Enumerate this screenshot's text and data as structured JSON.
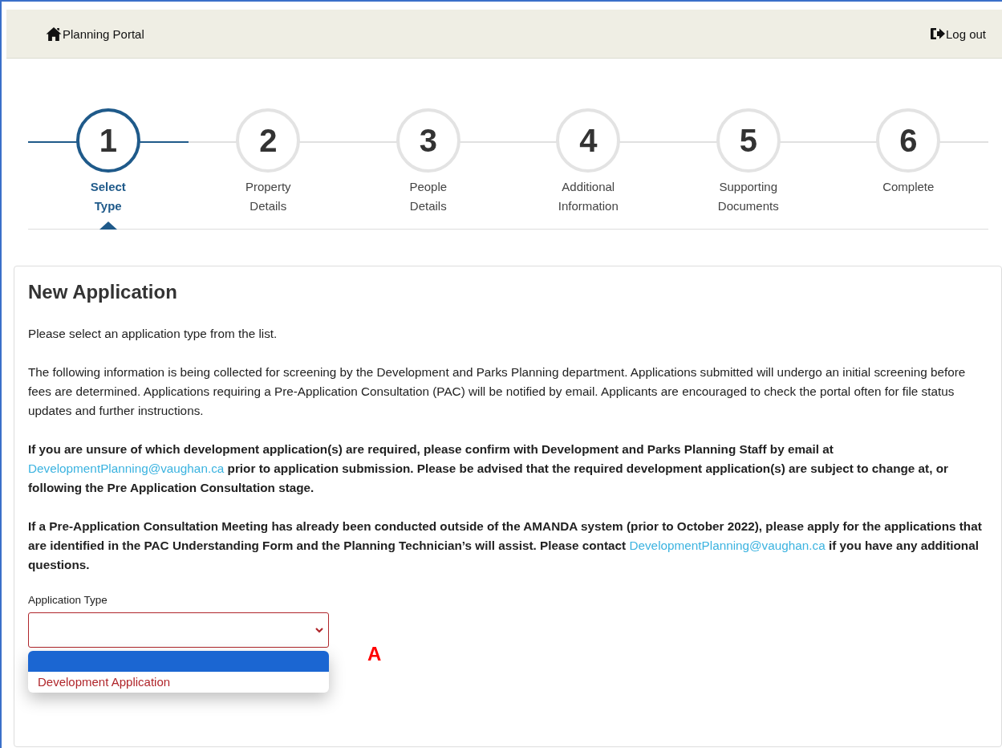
{
  "header": {
    "home": "Planning Portal",
    "logout": "Log out"
  },
  "steps": [
    {
      "number": "1",
      "label": "Select Type",
      "selected": true
    },
    {
      "number": "2",
      "label": "Property Details",
      "selected": false
    },
    {
      "number": "3",
      "label": "People Details",
      "selected": false
    },
    {
      "number": "4",
      "label": "Additional Information",
      "selected": false
    },
    {
      "number": "5",
      "label": "Supporting Documents",
      "selected": false
    },
    {
      "number": "6",
      "label": "Complete",
      "selected": false
    }
  ],
  "card": {
    "title": "New Application",
    "paragraphs": [
      {
        "bold": false,
        "parts": [
          {
            "text": "Please select an application type from the list.",
            "link": false
          }
        ]
      },
      {
        "bold": false,
        "parts": [
          {
            "text": "The following information is being collected for screening by the Development and Parks Planning department. Applications submitted will undergo an initial screening before fees are determined. Applications requiring a Pre-Application Consultation (PAC) will be notified by email. Applicants are encouraged to check the portal often for file status updates and further instructions.",
            "link": false
          }
        ]
      },
      {
        "bold": true,
        "parts": [
          {
            "text": "If you are unsure of which development application(s) are required, please confirm with Development and Parks Planning Staff by email at ",
            "link": false
          },
          {
            "text": "DevelopmentPlanning@vaughan.ca",
            "link": true
          },
          {
            "text": " prior to application submission. Please be advised that the required development application(s) are subject to change at, or following the Pre Application Consultation stage.",
            "link": false
          }
        ]
      },
      {
        "bold": true,
        "parts": [
          {
            "text": "If a Pre-Application Consultation Meeting has already been conducted outside of the AMANDA system (prior to October 2022), please apply for the applications that are identified in the PAC Understanding Form and the Planning Technician’s will assist. Please contact ",
            "link": false
          },
          {
            "text": "DevelopmentPlanning@vaughan.ca",
            "link": true
          },
          {
            "text": " if you have any additional questions.",
            "link": false
          }
        ]
      }
    ],
    "field": {
      "label": "Application Type",
      "invalid": true,
      "options": [
        {
          "selected": true
        },
        {
          "label": "Development Application",
          "selected": false
        }
      ]
    },
    "annotation": "A"
  }
}
